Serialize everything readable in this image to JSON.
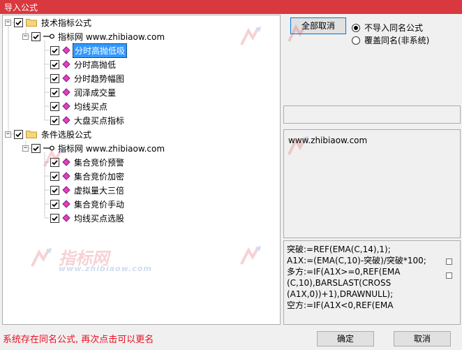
{
  "window": {
    "title": "导入公式"
  },
  "tree": {
    "group1": {
      "label": "技术指标公式",
      "subgroup_label": "指标网 www.zhibiaow.com",
      "items": [
        "分时高抛低吸",
        "分时高抛低",
        "分时趋势幅图",
        "润泽成交量",
        "均线买点",
        "大盘买点指标"
      ]
    },
    "group2": {
      "label": "条件选股公式",
      "subgroup_label": "指标网 www.zhibiaow.com",
      "items": [
        "集合竞价预警",
        "集合竞价加密",
        "虚拟量大三倍",
        "集合竞价手动",
        "均线买点选股"
      ]
    }
  },
  "actions": {
    "deselect_all": "全部取消",
    "radio_skip": "不导入同名公式",
    "radio_overwrite": "覆盖同名(非系统)"
  },
  "description": {
    "text": "www.zhibiaow.com"
  },
  "code_preview": {
    "lines": [
      "突破:=REF(EMA(C,14),1);",
      "A1X:=(EMA(C,10)-突破)/突破*100;",
      "多方:=IF(A1X>=0,REF(EMA",
      "(C,10),BARSLAST(CROSS",
      "(A1X,0))+1),DRAWNULL);",
      "空方:=IF(A1X<0,REF(EMA"
    ]
  },
  "status": {
    "message": "系统存在同名公式, 再次点击可以更名"
  },
  "footer": {
    "ok": "确定",
    "cancel": "取消"
  },
  "watermark": {
    "name": "指标网",
    "url": "www.zhibiaow.com"
  },
  "colors": {
    "titlebar": "#d9383e",
    "selection": "#3399ff",
    "status_text": "#e81123",
    "watermark_blue": "#2c66c9"
  }
}
